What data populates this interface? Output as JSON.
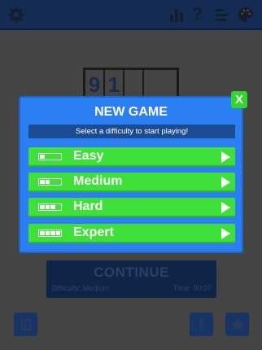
{
  "topbar": {
    "icons": [
      "gear-icon",
      "bar-chart-icon",
      "help-icon",
      "list-icon",
      "palette-icon"
    ],
    "help_glyph": "?"
  },
  "board": {
    "digits": [
      "9",
      "1",
      "",
      ""
    ]
  },
  "continue_panel": {
    "label": "CONTINUE",
    "difficulty": "Difficulty: Medium",
    "time": "Time: 00:07"
  },
  "modal": {
    "title": "NEW GAME",
    "subtitle": "Select a difficulty to start playing!",
    "close_label": "X",
    "options": [
      {
        "label": "Easy",
        "level": 1
      },
      {
        "label": "Medium",
        "level": 2
      },
      {
        "label": "Hard",
        "level": 3
      },
      {
        "label": "Expert",
        "level": 4
      }
    ]
  },
  "bottom": {
    "left_icon": "book-icon",
    "middle_icon": "facebook-icon",
    "facebook_glyph": "f",
    "right_icon": "star-icon"
  },
  "colors": {
    "modal_bg": "#2b7ff2",
    "option_bg": "#3fe03a",
    "topbar_bg": "#142b53"
  }
}
